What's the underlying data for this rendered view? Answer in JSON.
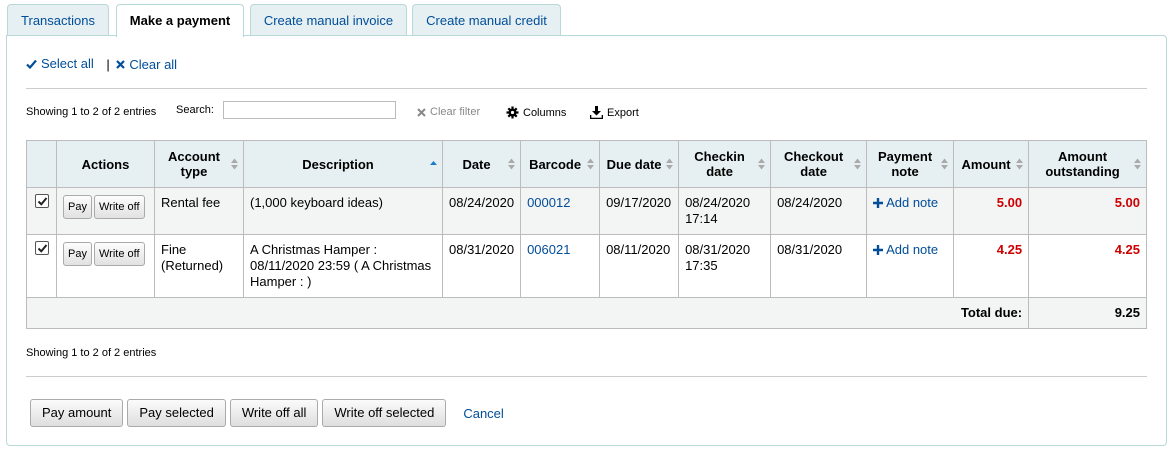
{
  "tabs": [
    {
      "label": "Transactions",
      "active": false
    },
    {
      "label": "Make a payment",
      "active": true
    },
    {
      "label": "Create manual invoice",
      "active": false
    },
    {
      "label": "Create manual credit",
      "active": false
    }
  ],
  "select": {
    "select_all": "Select all",
    "separator": "|",
    "clear_all": "Clear all"
  },
  "toolbar": {
    "info": "Showing 1 to 2 of 2 entries",
    "search_label": "Search:",
    "search_value": "",
    "clear_filter": "Clear filter",
    "columns": "Columns",
    "export": "Export"
  },
  "table": {
    "headers": {
      "actions": "Actions",
      "account_type": "Account type",
      "description": "Description",
      "date": "Date",
      "barcode": "Barcode",
      "due_date": "Due date",
      "checkin_date": "Checkin date",
      "checkout_date": "Checkout date",
      "payment_note": "Payment note",
      "amount": "Amount",
      "amount_outstanding": "Amount outstanding"
    },
    "rows": [
      {
        "checked": true,
        "pay": "Pay",
        "write_off": "Write off",
        "account_type": "Rental fee",
        "description": "(1,000 keyboard ideas)",
        "date": "08/24/2020",
        "barcode": "000012",
        "due_date": "09/17/2020",
        "checkin_date": "08/24/2020 17:14",
        "checkout_date": "08/24/2020",
        "payment_note": "Add note",
        "amount": "5.00",
        "amount_outstanding": "5.00"
      },
      {
        "checked": true,
        "pay": "Pay",
        "write_off": "Write off",
        "account_type": "Fine (Returned)",
        "description": "A Christmas Hamper : 08/11/2020 23:59 ( A Christmas Hamper : )",
        "date": "08/31/2020",
        "barcode": "006021",
        "due_date": "08/11/2020",
        "checkin_date": "08/31/2020 17:35",
        "checkout_date": "08/31/2020",
        "payment_note": "Add note",
        "amount": "4.25",
        "amount_outstanding": "4.25"
      }
    ],
    "total_label": "Total due:",
    "total_value": "9.25"
  },
  "bottom_info": "Showing 1 to 2 of 2 entries",
  "actions": {
    "pay_amount": "Pay amount",
    "pay_selected": "Pay selected",
    "write_off_all": "Write off all",
    "write_off_selected": "Write off selected",
    "cancel": "Cancel"
  },
  "colors": {
    "link": "#004d99",
    "amount": "#cc0000",
    "header_bg": "#e6f0f2",
    "tab_border": "#b9d8d9"
  },
  "icons": [
    "check-icon",
    "x-icon",
    "gear-icon",
    "download-icon",
    "plus-icon",
    "sort-icon",
    "sort-asc-icon"
  ]
}
